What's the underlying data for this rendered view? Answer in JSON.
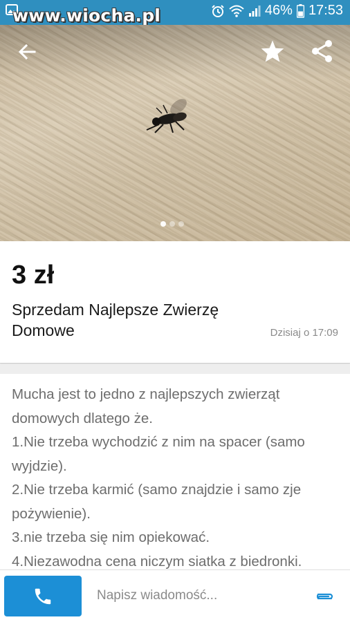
{
  "status_bar": {
    "watermark": "www.wiocha.pl",
    "battery": "46%",
    "time": "17:53",
    "icons": [
      "image-icon",
      "alarm-icon",
      "wifi-icon",
      "signal-icon",
      "battery-icon"
    ]
  },
  "hero": {
    "icons": [
      "back-arrow-icon",
      "star-icon",
      "share-icon"
    ],
    "image_count": 3,
    "active_image": 1
  },
  "listing": {
    "price": "3 zł",
    "title": "Sprzedam Najlepsze Zwierzę Domowe",
    "date": "Dzisiaj o 17:09"
  },
  "description": {
    "lines": [
      "Mucha jest to jedno z najlepszych zwierząt domowych dlatego że.",
      "1.Nie trzeba wychodzić z nim na spacer (samo wyjdzie).",
      "2.Nie trzeba karmić (samo znajdzie i samo zje pożywienie).",
      "3.nie trzeba się nim opiekować.",
      "4.Niezawodna cena niczym siatka z biedronki."
    ]
  },
  "bottom_bar": {
    "message_placeholder": "Napisz wiadomość...",
    "icons": [
      "phone-icon",
      "attachment-icon"
    ]
  },
  "colors": {
    "status_bar": "#2f8fbf",
    "call_button": "#1c8fd6",
    "attach_icon": "#1c8fd6"
  }
}
